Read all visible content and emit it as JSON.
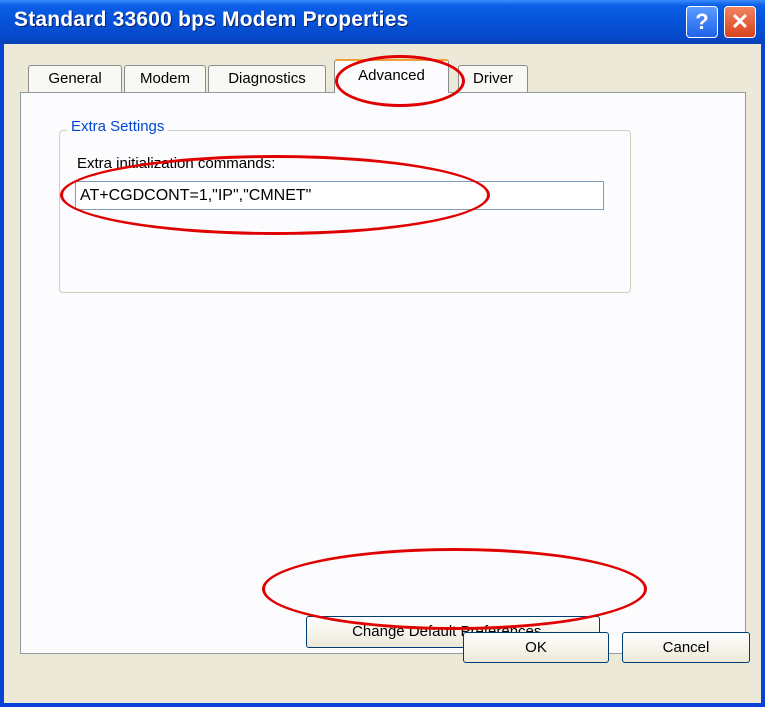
{
  "window": {
    "title": "Standard 33600 bps Modem Properties",
    "help_glyph": "?",
    "close_glyph": "✕"
  },
  "tabs": [
    {
      "label": "General"
    },
    {
      "label": "Modem"
    },
    {
      "label": "Diagnostics"
    },
    {
      "label": "Advanced",
      "active": true
    },
    {
      "label": "Driver"
    }
  ],
  "extra_settings": {
    "group_label": "Extra Settings",
    "field_label": "Extra initialization commands:",
    "field_value": "AT+CGDCONT=1,\"IP\",\"CMNET\""
  },
  "buttons": {
    "change_prefs": "Change Default Preferences...",
    "ok": "OK",
    "cancel": "Cancel"
  },
  "colors": {
    "titlebar": "#0652d8",
    "annotation": "#e00000",
    "group_label": "#0046d5",
    "dialog_bg": "#ece9d8"
  }
}
